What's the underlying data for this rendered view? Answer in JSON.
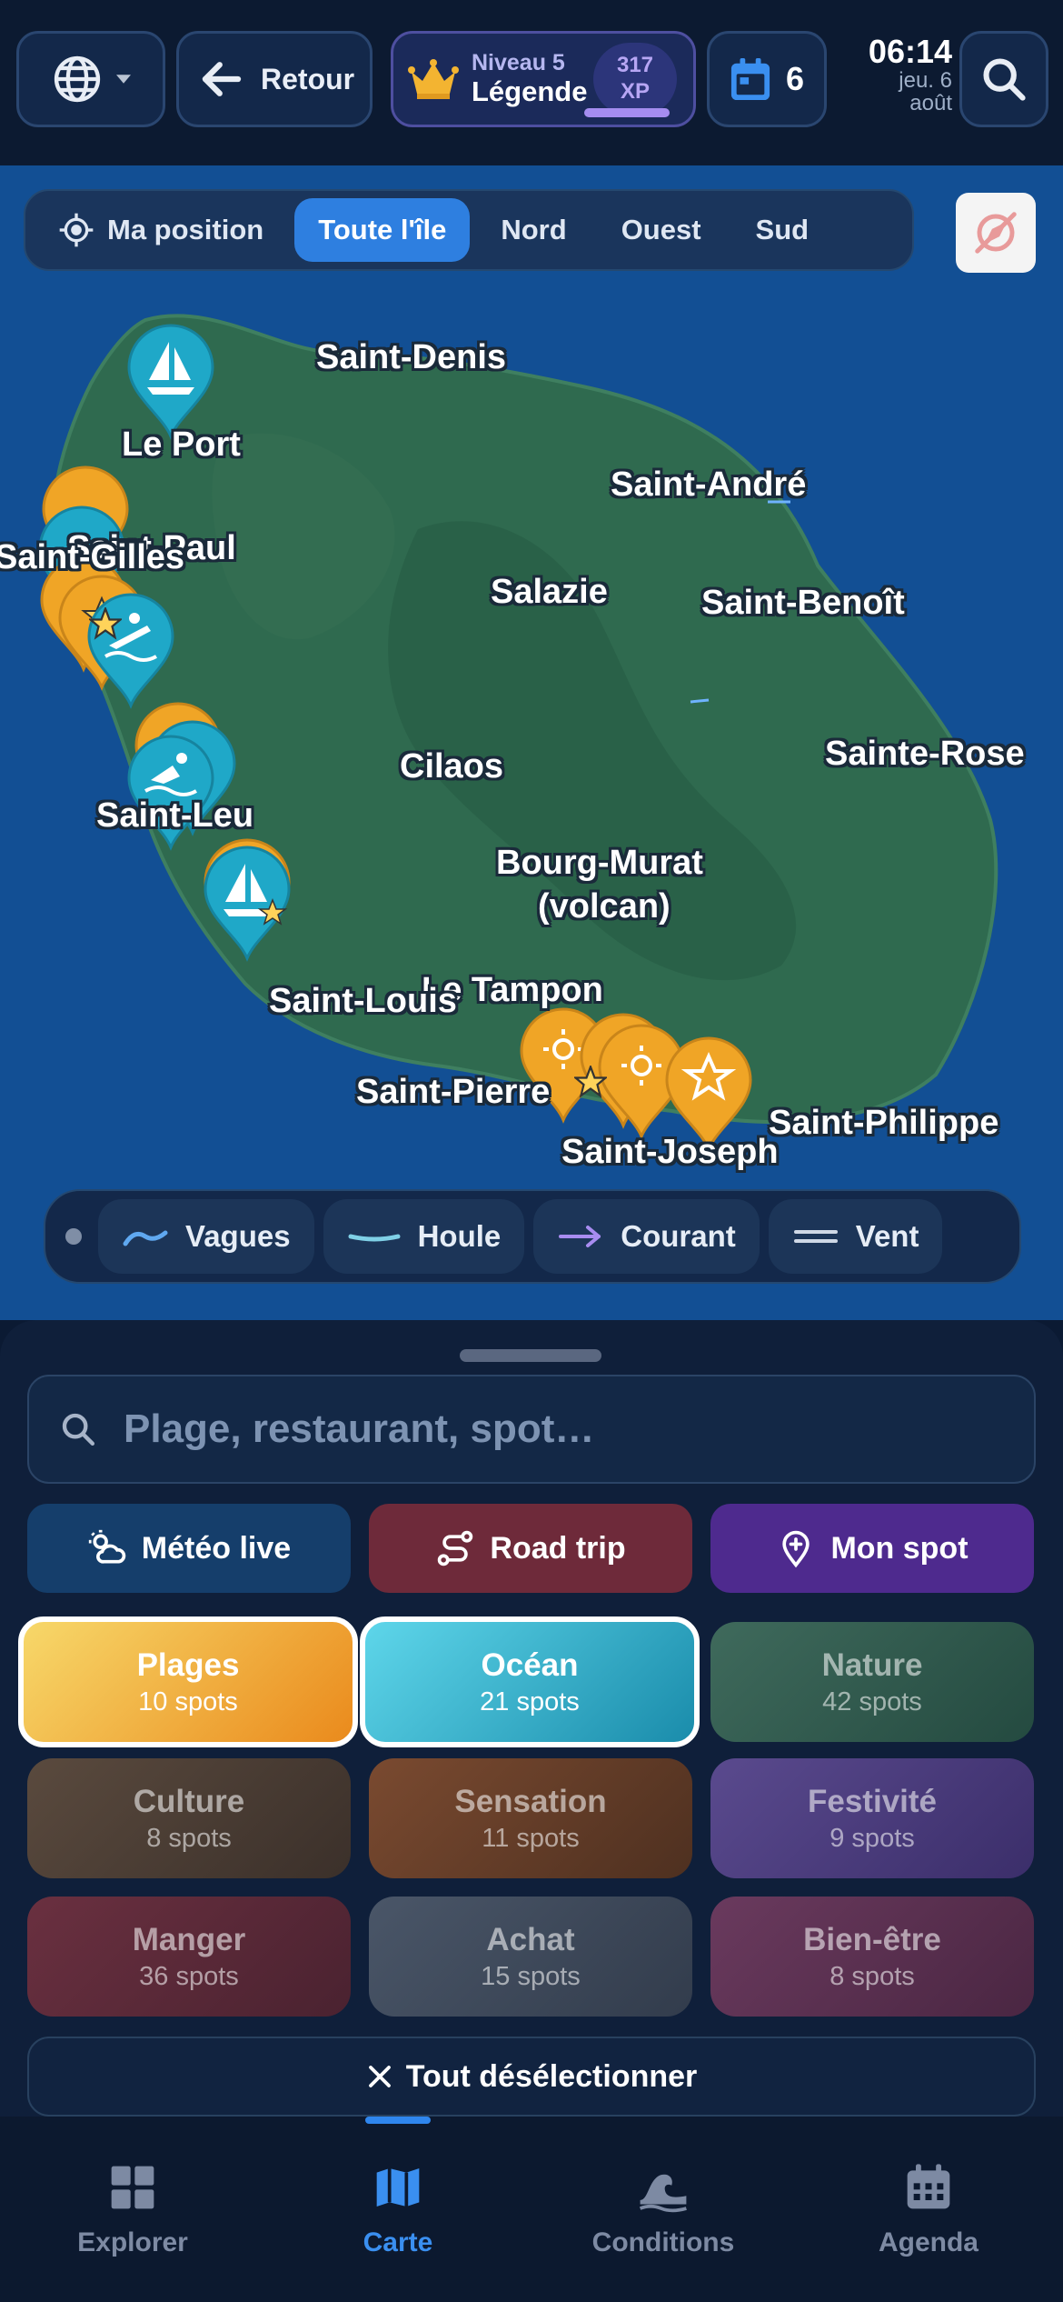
{
  "header": {
    "language_icon": "globe-icon",
    "back_label": "Retour",
    "level_label": "Niveau 5",
    "rank_label": "Légende",
    "xp_value": "317",
    "xp_unit": "XP",
    "xp_progress": 1.0,
    "events_count": "6",
    "time": "06:14",
    "date_line1": "jeu. 6",
    "date_line2": "août"
  },
  "map": {
    "regions": [
      "Ma position",
      "Toute l'île",
      "Nord",
      "Ouest",
      "Sud"
    ],
    "active_region": "Toute l'île",
    "cities": {
      "saint_denis": "Saint-Denis",
      "le_port": "Le Port",
      "saint_andre": "Saint-André",
      "saint_paul": "Saint-Paul",
      "saint_gilles": "Saint-Gilles",
      "salazie": "Salazie",
      "saint_benoit": "Saint-Benoît",
      "sainte_rose": "Sainte-Rose",
      "cilaos": "Cilaos",
      "saint_leu": "Saint-Leu",
      "bourg_murat_1": "Bourg-Murat",
      "bourg_murat_2": "(volcan)",
      "le_tampon": "Le Tampon",
      "saint_louis": "Saint-Louis",
      "saint_pierre": "Saint-Pierre",
      "saint_joseph": "Saint-Joseph",
      "saint_philippe": "Saint-Philippe"
    },
    "layers": [
      "Vagues",
      "Houle",
      "Courant",
      "Vent"
    ],
    "colors": {
      "ocean": "#124f94",
      "land": "#2f6a4f",
      "pin_beach": "#f0a526",
      "pin_ocean": "#1fa8c8"
    }
  },
  "sheet": {
    "search_placeholder": "Plage, restaurant, spot…",
    "quick_actions": [
      "Météo live",
      "Road trip",
      "Mon spot"
    ],
    "categories": [
      {
        "name": "Plages",
        "count": "10 spots",
        "selected": true
      },
      {
        "name": "Océan",
        "count": "21 spots",
        "selected": true
      },
      {
        "name": "Nature",
        "count": "42 spots",
        "selected": false
      },
      {
        "name": "Culture",
        "count": "8 spots",
        "selected": false
      },
      {
        "name": "Sensation",
        "count": "11 spots",
        "selected": false
      },
      {
        "name": "Festivité",
        "count": "9 spots",
        "selected": false
      },
      {
        "name": "Manger",
        "count": "36 spots",
        "selected": false
      },
      {
        "name": "Achat",
        "count": "15 spots",
        "selected": false
      },
      {
        "name": "Bien-être",
        "count": "8 spots",
        "selected": false
      }
    ],
    "deselect_label": "Tout désélectionner"
  },
  "nav": {
    "items": [
      "Explorer",
      "Carte",
      "Conditions",
      "Agenda"
    ],
    "active": "Carte"
  }
}
